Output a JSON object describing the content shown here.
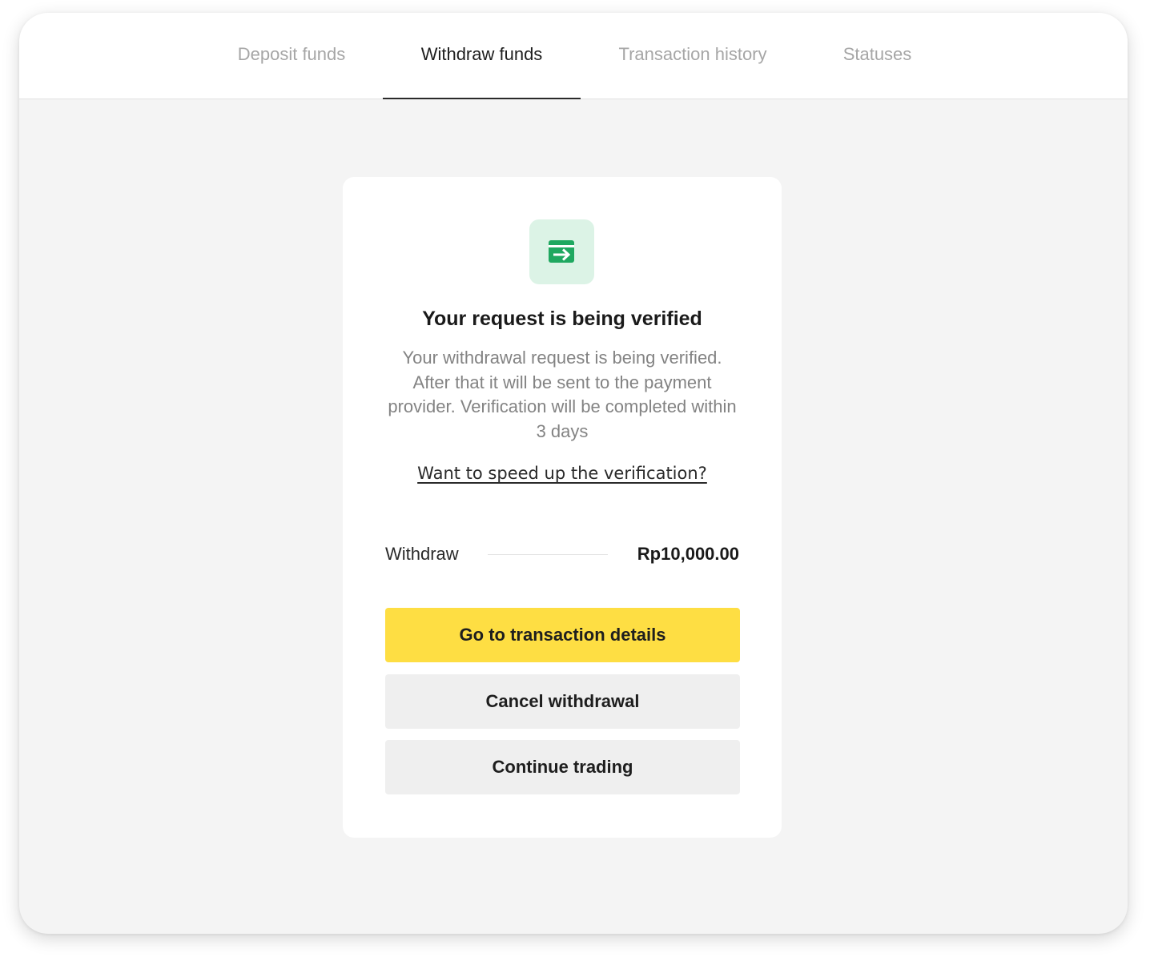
{
  "tabs": [
    {
      "label": "Deposit funds",
      "active": false
    },
    {
      "label": "Withdraw funds",
      "active": true
    },
    {
      "label": "Transaction history",
      "active": false
    },
    {
      "label": "Statuses",
      "active": false
    }
  ],
  "status": {
    "icon": "card-transfer-icon",
    "title": "Your request is being verified",
    "description": "Your withdrawal request is being verified. After that it will be sent to the payment provider. Verification will be completed within 3 days",
    "speedup_link": "Want to speed up the verification?"
  },
  "summary": {
    "label": "Withdraw",
    "amount": "Rp10,000.00"
  },
  "actions": {
    "details": "Go to transaction details",
    "cancel": "Cancel withdrawal",
    "continue": "Continue trading"
  },
  "colors": {
    "accent_yellow": "#fede43",
    "icon_green": "#1fa860",
    "icon_bg": "#dcf3e6",
    "secondary_button": "#efefef"
  }
}
